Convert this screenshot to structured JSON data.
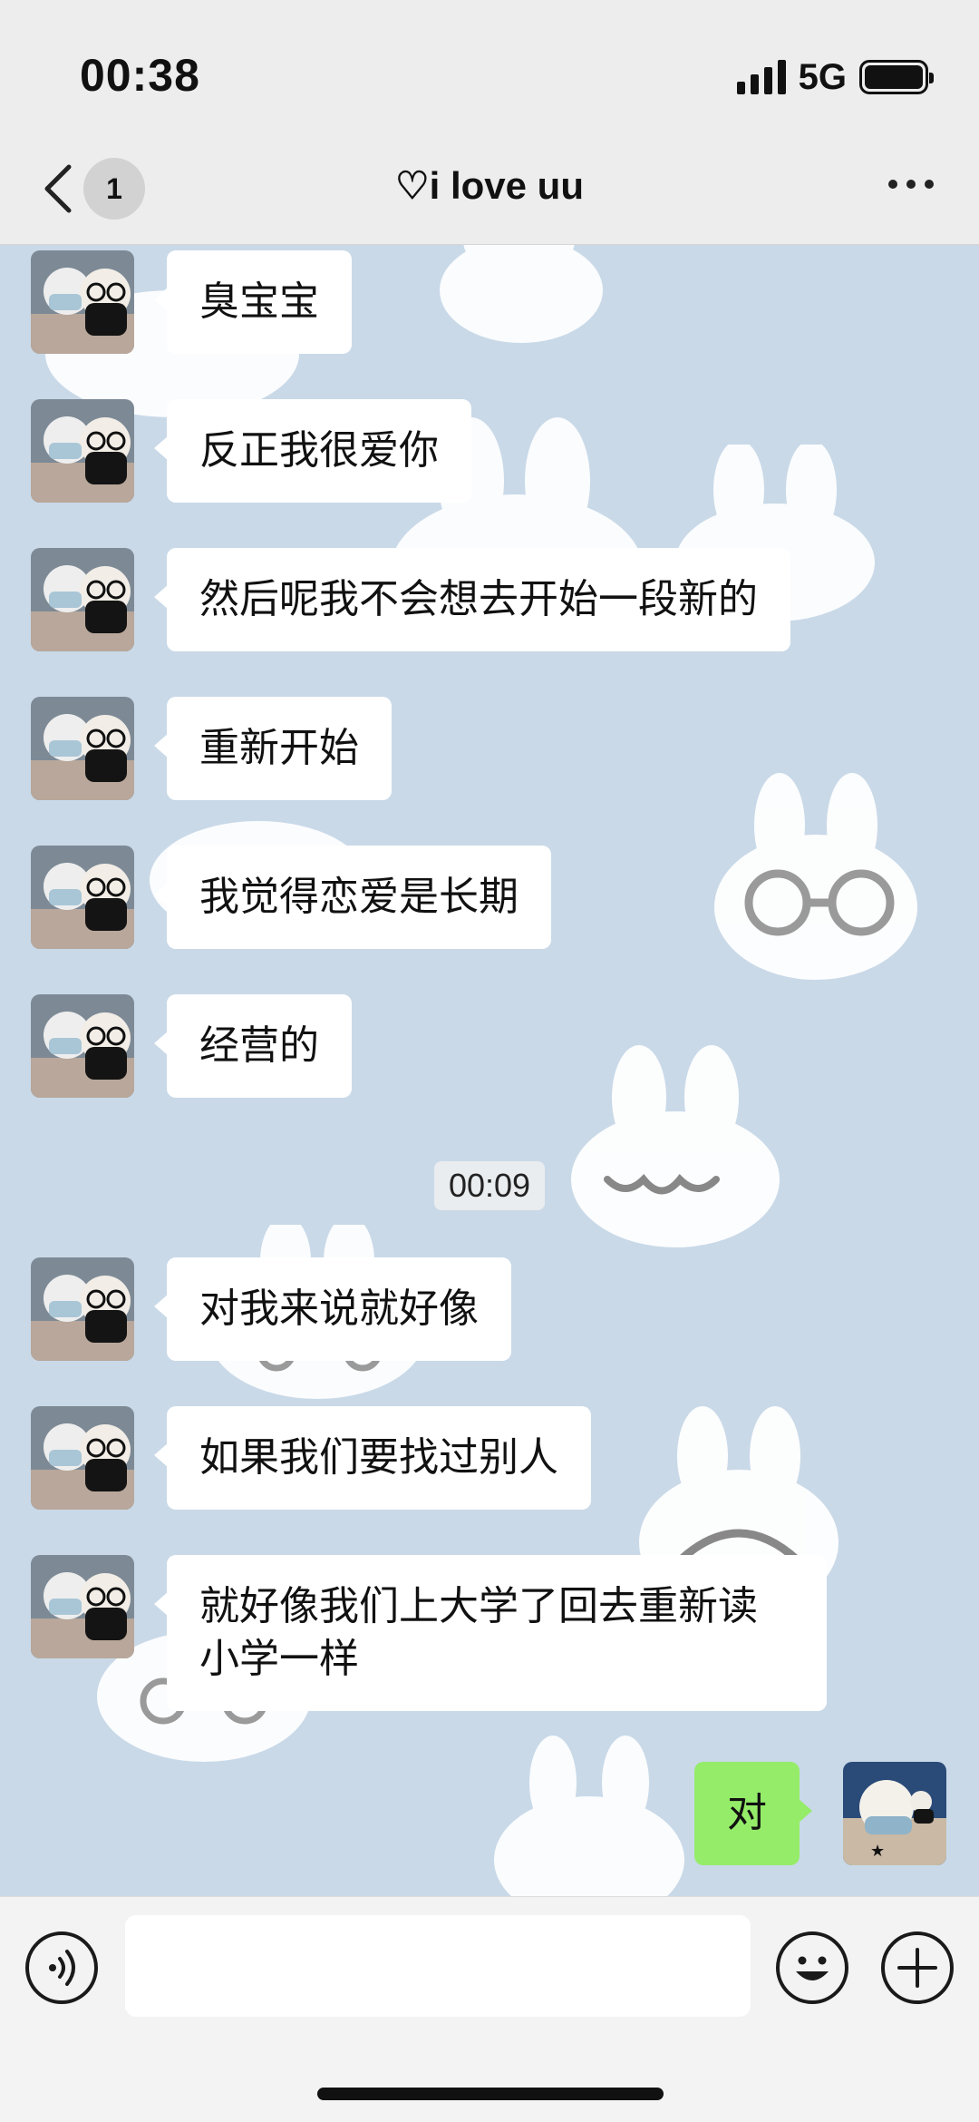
{
  "status_bar": {
    "time": "00:38",
    "network": "5G"
  },
  "header": {
    "unread_count": "1",
    "title": "♡i love uu"
  },
  "messages": [
    {
      "text": "臭宝宝"
    },
    {
      "text": "反正我很爱你"
    },
    {
      "text": "然后呢我不会想去开始一段新的"
    },
    {
      "text": "重新开始"
    },
    {
      "text": "我觉得恋爱是长期"
    },
    {
      "text": "经营的"
    },
    {
      "text": "对我来说就好像"
    },
    {
      "text": "如果我们要找过别人"
    },
    {
      "text": "就好像我们上大学了回去重新读小学一样"
    },
    {
      "text": "对"
    }
  ],
  "time_separator": "00:09",
  "input": {
    "placeholder": ""
  },
  "colors": {
    "outgoing_bubble": "#95ec69",
    "incoming_bubble": "#ffffff",
    "chat_bg": "#c9d9e8"
  },
  "icons": [
    "back-arrow-icon",
    "more-icon",
    "voice-icon",
    "emoji-icon",
    "plus-icon"
  ]
}
